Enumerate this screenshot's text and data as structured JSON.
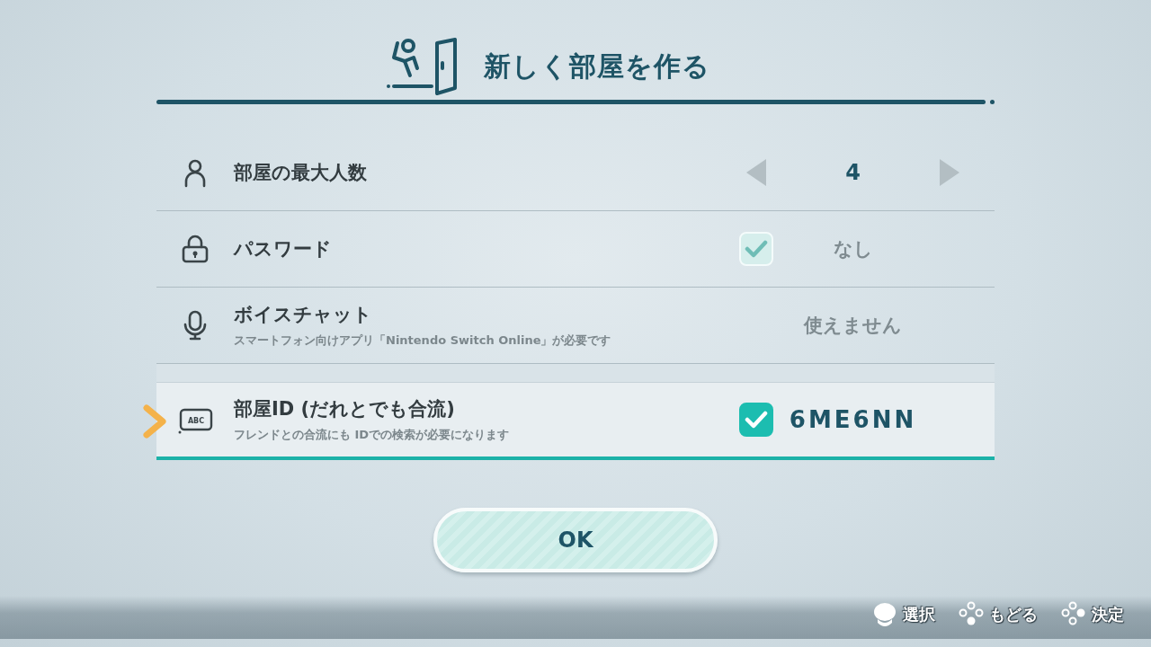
{
  "header": {
    "title": "新しく部屋を作る"
  },
  "settings": [
    {
      "kind": "stepper",
      "label": "部屋の最大人数",
      "value": "4",
      "selected": false
    },
    {
      "kind": "toggle",
      "label": "パスワード",
      "checked": true,
      "disabled": true,
      "value": "なし",
      "selected": false
    },
    {
      "kind": "info",
      "label": "ボイスチャット",
      "note": "スマートフォン向けアプリ「Nintendo Switch Online」が必要です",
      "value": "使えません",
      "disabled": true,
      "selected": false
    },
    {
      "kind": "toggle",
      "icon_text": "ABC",
      "label": "部屋ID (だれとでも合流)",
      "note": "フレンドとの合流にも IDでの検索が必要になります",
      "checked": true,
      "disabled": false,
      "value": "6ME6NN",
      "selected": true
    }
  ],
  "ok_button": {
    "label": "OK"
  },
  "controls": [
    {
      "label": "選択"
    },
    {
      "label": "もどる"
    },
    {
      "label": "決定"
    }
  ]
}
